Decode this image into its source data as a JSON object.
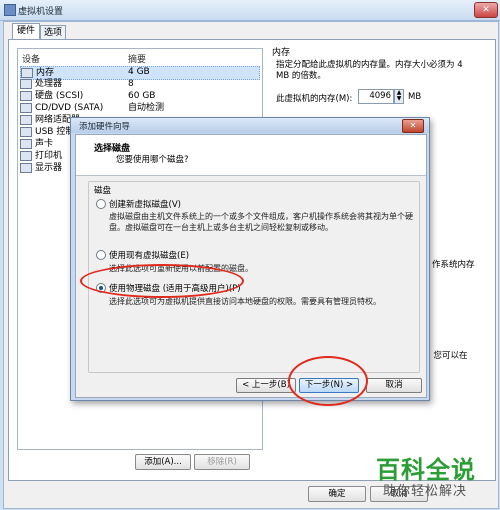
{
  "window": {
    "title": "虚拟机设置",
    "close_glyph": "✕"
  },
  "tabs": [
    {
      "label": "硬件"
    },
    {
      "label": "选项"
    }
  ],
  "device_list": {
    "headers": {
      "device": "设备",
      "summary": "摘要"
    },
    "items": [
      {
        "label": "内存",
        "summary": "4 GB",
        "icon": "memory-icon"
      },
      {
        "label": "处理器",
        "summary": "8",
        "icon": "cpu-icon"
      },
      {
        "label": "硬盘 (SCSI)",
        "summary": "60 GB",
        "icon": "disk-icon"
      },
      {
        "label": "CD/DVD (SATA)",
        "summary": "自动检测",
        "icon": "cd-icon"
      },
      {
        "label": "网络适配器",
        "summary": "",
        "icon": "network-icon"
      },
      {
        "label": "USB 控制器",
        "summary": "",
        "icon": "usb-icon"
      },
      {
        "label": "声卡",
        "summary": "",
        "icon": "sound-icon"
      },
      {
        "label": "打印机",
        "summary": "",
        "icon": "printer-icon"
      },
      {
        "label": "显示器",
        "summary": "",
        "icon": "display-icon"
      }
    ],
    "add_label": "添加(A)...",
    "remove_label": "移除(R)"
  },
  "memory": {
    "title": "内存",
    "description": "指定分配给此虚拟机的内存量。内存大小必须为 4 MB 的倍数。",
    "field_label": "此虚拟机的内存(M):",
    "value": "4096",
    "unit": "MB",
    "fragment_1": "作系统内存",
    "fragment_2": "。您可以在"
  },
  "footer": {
    "ok_label": "确定",
    "cancel_label": "取消"
  },
  "dialog": {
    "title": "添加硬件向导",
    "heading": "选择磁盘",
    "subheading": "您要使用哪个磁盘?",
    "group_label": "磁盘",
    "options": [
      {
        "label": "创建新虚拟磁盘(V)",
        "description": "虚拟磁盘由主机文件系统上的一个或多个文件组成，客户机操作系统会将其视为单个硬盘。虚拟磁盘可在一台主机上或多台主机之间轻松复制或移动。",
        "selected": false
      },
      {
        "label": "使用现有虚拟磁盘(E)",
        "description": "选择此选项可重新使用以前配置的磁盘。",
        "selected": false
      },
      {
        "label": "使用物理磁盘 (适用于高级用户)(P)",
        "description": "选择此选项可为虚拟机提供直接访问本地硬盘的权限。需要具有管理员特权。",
        "selected": true
      }
    ],
    "back_label": "< 上一步(B)",
    "next_label": "下一步(N) >",
    "cancel_label": "取消",
    "close_glyph": "✕"
  },
  "watermark": {
    "line1": "百科全说",
    "line2": "助你轻松解决"
  },
  "colors": {
    "annotation": "#e02a1e",
    "watermark": "#2a9d34",
    "selection": "#cfe3fb"
  }
}
